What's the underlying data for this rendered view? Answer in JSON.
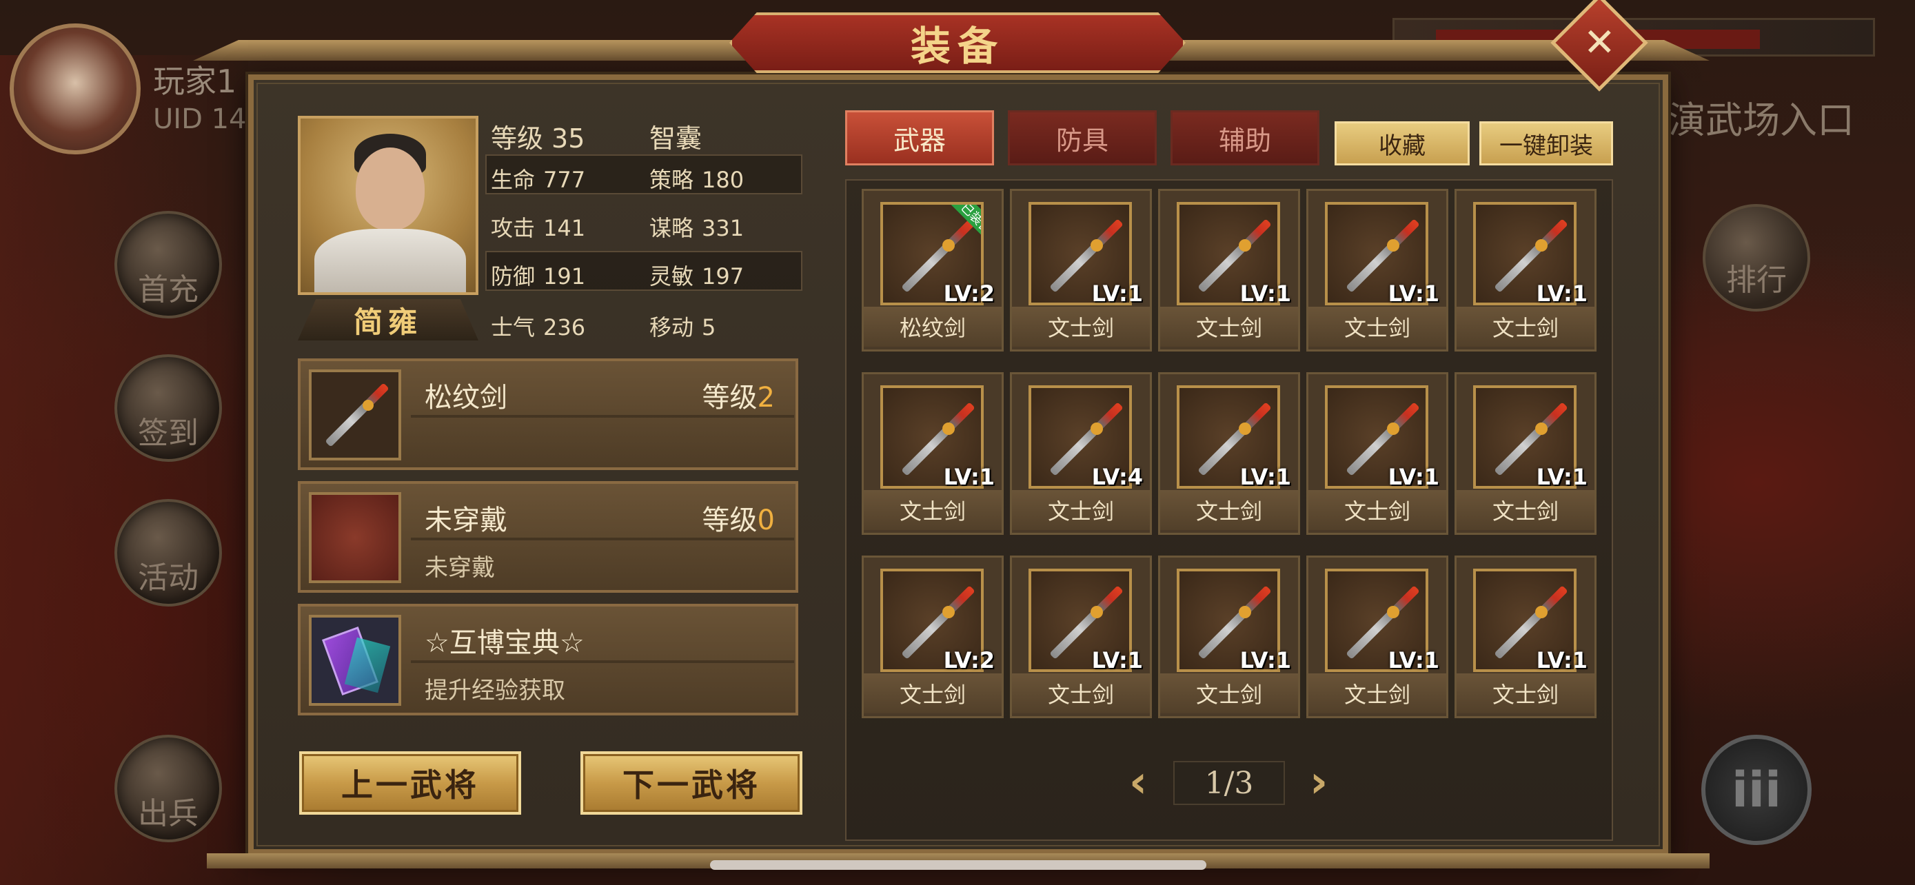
{
  "background": {
    "player_name": "玩家1",
    "player_uid": "UID 14",
    "arena_entry": "演武场入口",
    "side_buttons": [
      "首充",
      "签到",
      "活动",
      "出兵"
    ],
    "rank_button": "排行",
    "menu_button": "iii"
  },
  "window": {
    "title": "装备",
    "close_symbol": "✕"
  },
  "general": {
    "name": "简雍",
    "level_label": "等级",
    "level_value": "35",
    "trait": "智囊",
    "stats": [
      {
        "label": "生命",
        "value": "777"
      },
      {
        "label": "策略",
        "value": "180"
      },
      {
        "label": "攻击",
        "value": "141"
      },
      {
        "label": "谋略",
        "value": "331"
      },
      {
        "label": "防御",
        "value": "191"
      },
      {
        "label": "灵敏",
        "value": "197"
      },
      {
        "label": "士气",
        "value": "236"
      },
      {
        "label": "移动",
        "value": "5"
      }
    ]
  },
  "slots": [
    {
      "name": "松纹剑",
      "level_label": "等级",
      "level": "2",
      "desc": "",
      "icon": "sword-icon"
    },
    {
      "name": "未穿戴",
      "level_label": "等级",
      "level": "0",
      "desc": "未穿戴",
      "icon": "empty-armor-icon"
    },
    {
      "name": "☆互博宝典☆",
      "level_label": "",
      "level": "",
      "desc": "提升经验获取",
      "icon": "book-icon"
    }
  ],
  "nav": {
    "prev": "上一武将",
    "next": "下一武将"
  },
  "tabs": [
    {
      "label": "武器",
      "active": true
    },
    {
      "label": "防具",
      "active": false
    },
    {
      "label": "辅助",
      "active": false
    }
  ],
  "actions": {
    "favorite": "收藏",
    "unequip_all": "一键卸装"
  },
  "equipped_tag": "已装备",
  "items": [
    {
      "name": "松纹剑",
      "lv": "LV:2",
      "equipped": true
    },
    {
      "name": "文士剑",
      "lv": "LV:1"
    },
    {
      "name": "文士剑",
      "lv": "LV:1"
    },
    {
      "name": "文士剑",
      "lv": "LV:1"
    },
    {
      "name": "文士剑",
      "lv": "LV:1"
    },
    {
      "name": "文士剑",
      "lv": "LV:1"
    },
    {
      "name": "文士剑",
      "lv": "LV:4"
    },
    {
      "name": "文士剑",
      "lv": "LV:1"
    },
    {
      "name": "文士剑",
      "lv": "LV:1"
    },
    {
      "name": "文士剑",
      "lv": "LV:1"
    },
    {
      "name": "文士剑",
      "lv": "LV:2"
    },
    {
      "name": "文士剑",
      "lv": "LV:1"
    },
    {
      "name": "文士剑",
      "lv": "LV:1"
    },
    {
      "name": "文士剑",
      "lv": "LV:1"
    },
    {
      "name": "文士剑",
      "lv": "LV:1"
    }
  ],
  "pagination": {
    "text": "1/3",
    "prev_icon": "chevron-left-icon",
    "next_icon": "chevron-right-icon"
  },
  "colors": {
    "accent_gold": "#f0b040",
    "tab_active": "#c85038",
    "tab_inactive": "#7a2a20",
    "equipped_green": "#2aa040"
  }
}
